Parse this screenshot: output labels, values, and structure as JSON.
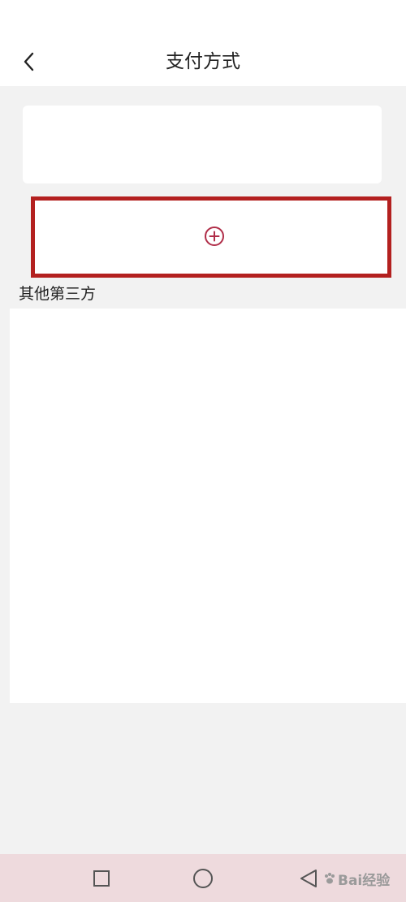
{
  "header": {
    "title": "支付方式",
    "back_icon": "chevron-left-icon"
  },
  "payment": {
    "add_icon": "plus-circle-icon",
    "section_label": "其他第三方"
  },
  "navbar": {
    "recent_icon": "square-icon",
    "home_icon": "circle-icon",
    "back_icon": "triangle-back-icon"
  },
  "watermark": {
    "text": "Bai经验"
  },
  "colors": {
    "highlight_border": "#b3201f",
    "accent": "#b02d48",
    "navbar_bg": "#eedadd",
    "page_bg": "#f2f2f2"
  }
}
